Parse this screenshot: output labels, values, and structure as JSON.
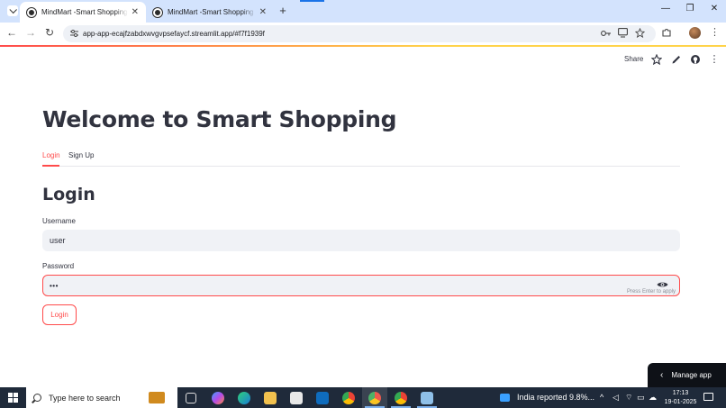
{
  "browser": {
    "tabs": [
      {
        "title": "MindMart -Smart Shopping - St",
        "active": true
      },
      {
        "title": "MindMart -Smart Shopping - St",
        "active": false
      }
    ],
    "tab_close_glyph": "✕",
    "new_tab_glyph": "+",
    "window_controls": {
      "minimize": "—",
      "maximize": "❐",
      "close": "✕"
    },
    "url": "app-app-ecajfzabdxwvgvpsefaycf.streamlit.app/#f7f1939f",
    "nav": {
      "back": "←",
      "forward": "→",
      "reload": "↻"
    }
  },
  "streamlit_header": {
    "share_label": "Share",
    "icons": [
      "star-icon",
      "edit-icon",
      "github-icon",
      "more-vert-icon"
    ]
  },
  "page": {
    "title": "Welcome to Smart Shopping",
    "tabs": [
      {
        "label": "Login",
        "active": true
      },
      {
        "label": "Sign Up",
        "active": false
      }
    ],
    "section_title": "Login",
    "username": {
      "label": "Username",
      "value": "user"
    },
    "password": {
      "label": "Password",
      "value": "•••",
      "hint": "Press Enter to apply"
    },
    "login_button": "Login"
  },
  "manage_app": {
    "label": "Manage app",
    "chevron": "‹"
  },
  "taskbar": {
    "search_placeholder": "Type here to search",
    "news": "India reported 9.8%...",
    "time": "17:13",
    "date": "19-01-2025"
  },
  "colors": {
    "accent": "#ff4b4b",
    "input_bg": "#f0f2f6",
    "text": "#31333f",
    "tabstrip": "#d3e3fd",
    "taskbar": "#1f2a3a"
  }
}
